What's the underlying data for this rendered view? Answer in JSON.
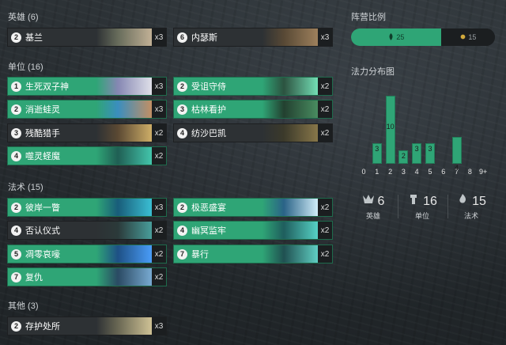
{
  "sections": {
    "champions": "英雄 (6)",
    "units": "单位 (16)",
    "spells": "法术 (15)",
    "others": "其他 (3)"
  },
  "cards": {
    "champions": [
      {
        "cost": "2",
        "name": "基兰",
        "count": "x3",
        "colors": [
          "#6a6f5d",
          "#c9b79b"
        ]
      },
      {
        "cost": "6",
        "name": "内瑟斯",
        "count": "x3",
        "colors": [
          "#5a4a35",
          "#a3845e"
        ]
      }
    ],
    "units": [
      {
        "cost": "1",
        "name": "生死双子神",
        "count": "x3",
        "colors": [
          "#8a86b6",
          "#e8e2ef"
        ]
      },
      {
        "cost": "2",
        "name": "受诅守侍",
        "count": "x2",
        "colors": [
          "#2c4e3d",
          "#77e1b8"
        ]
      },
      {
        "cost": "2",
        "name": "消逝蛙灵",
        "count": "x3",
        "colors": [
          "#3b8dc2",
          "#c98e64"
        ]
      },
      {
        "cost": "3",
        "name": "枯林看护",
        "count": "x2",
        "colors": [
          "#223b2c",
          "#4a8a5f"
        ]
      },
      {
        "cost": "3",
        "name": "残酷猎手",
        "count": "x2",
        "colors": [
          "#5d4a33",
          "#d6b46a"
        ]
      },
      {
        "cost": "4",
        "name": "纺沙巴凯",
        "count": "x2",
        "colors": [
          "#3c3a2a",
          "#8c7a4a"
        ]
      },
      {
        "cost": "4",
        "name": "噬灵蛏魔",
        "count": "x2",
        "colors": [
          "#1f5b52",
          "#44c7ae"
        ]
      }
    ],
    "spells": [
      {
        "cost": "2",
        "name": "彼岸一瞥",
        "count": "x3",
        "colors": [
          "#17597a",
          "#3bc0d8"
        ]
      },
      {
        "cost": "2",
        "name": "极恶盛宴",
        "count": "x2",
        "colors": [
          "#2a5f88",
          "#d8f0ff"
        ]
      },
      {
        "cost": "4",
        "name": "否认仪式",
        "count": "x2",
        "colors": [
          "#2b3a3a",
          "#4aa3a0"
        ]
      },
      {
        "cost": "4",
        "name": "幽冥监牢",
        "count": "x2",
        "colors": [
          "#1e5a5c",
          "#58d4c9"
        ]
      },
      {
        "cost": "5",
        "name": "凋零哀嚎",
        "count": "x2",
        "colors": [
          "#1d4c86",
          "#4b9cff"
        ]
      },
      {
        "cost": "7",
        "name": "暴行",
        "count": "x2",
        "colors": [
          "#1f4c4f",
          "#62d1c7"
        ]
      },
      {
        "cost": "7",
        "name": "复仇",
        "count": "x2",
        "colors": [
          "#2a4562",
          "#7caad6"
        ]
      }
    ],
    "others": [
      {
        "cost": "2",
        "name": "存护处所",
        "count": "x3",
        "colors": [
          "#6c6a55",
          "#d7c99a"
        ]
      }
    ]
  },
  "right_panel": {
    "region_title": "阵营比例",
    "region": [
      {
        "value": 25,
        "label": "25",
        "icon": "shadow-isles-icon",
        "color": "#2fa576"
      },
      {
        "value": 15,
        "label": "15",
        "icon": "shurima-icon",
        "color": "#1b1e20"
      }
    ],
    "curve_title": "法力分布图",
    "stats": [
      {
        "icon": "champion-icon",
        "value": "6",
        "label": "英雄"
      },
      {
        "icon": "unit-icon",
        "value": "16",
        "label": "单位"
      },
      {
        "icon": "spell-icon",
        "value": "15",
        "label": "法术"
      }
    ]
  },
  "chart_data": {
    "type": "bar",
    "title": "法力分布图",
    "categories": [
      "0",
      "1",
      "2",
      "3",
      "4",
      "5",
      "6",
      "7",
      "8",
      "9+"
    ],
    "series": [
      {
        "values": [
          0,
          3,
          10,
          2,
          3,
          3,
          0,
          4,
          0,
          0
        ]
      }
    ],
    "ylim": [
      0,
      10
    ]
  }
}
